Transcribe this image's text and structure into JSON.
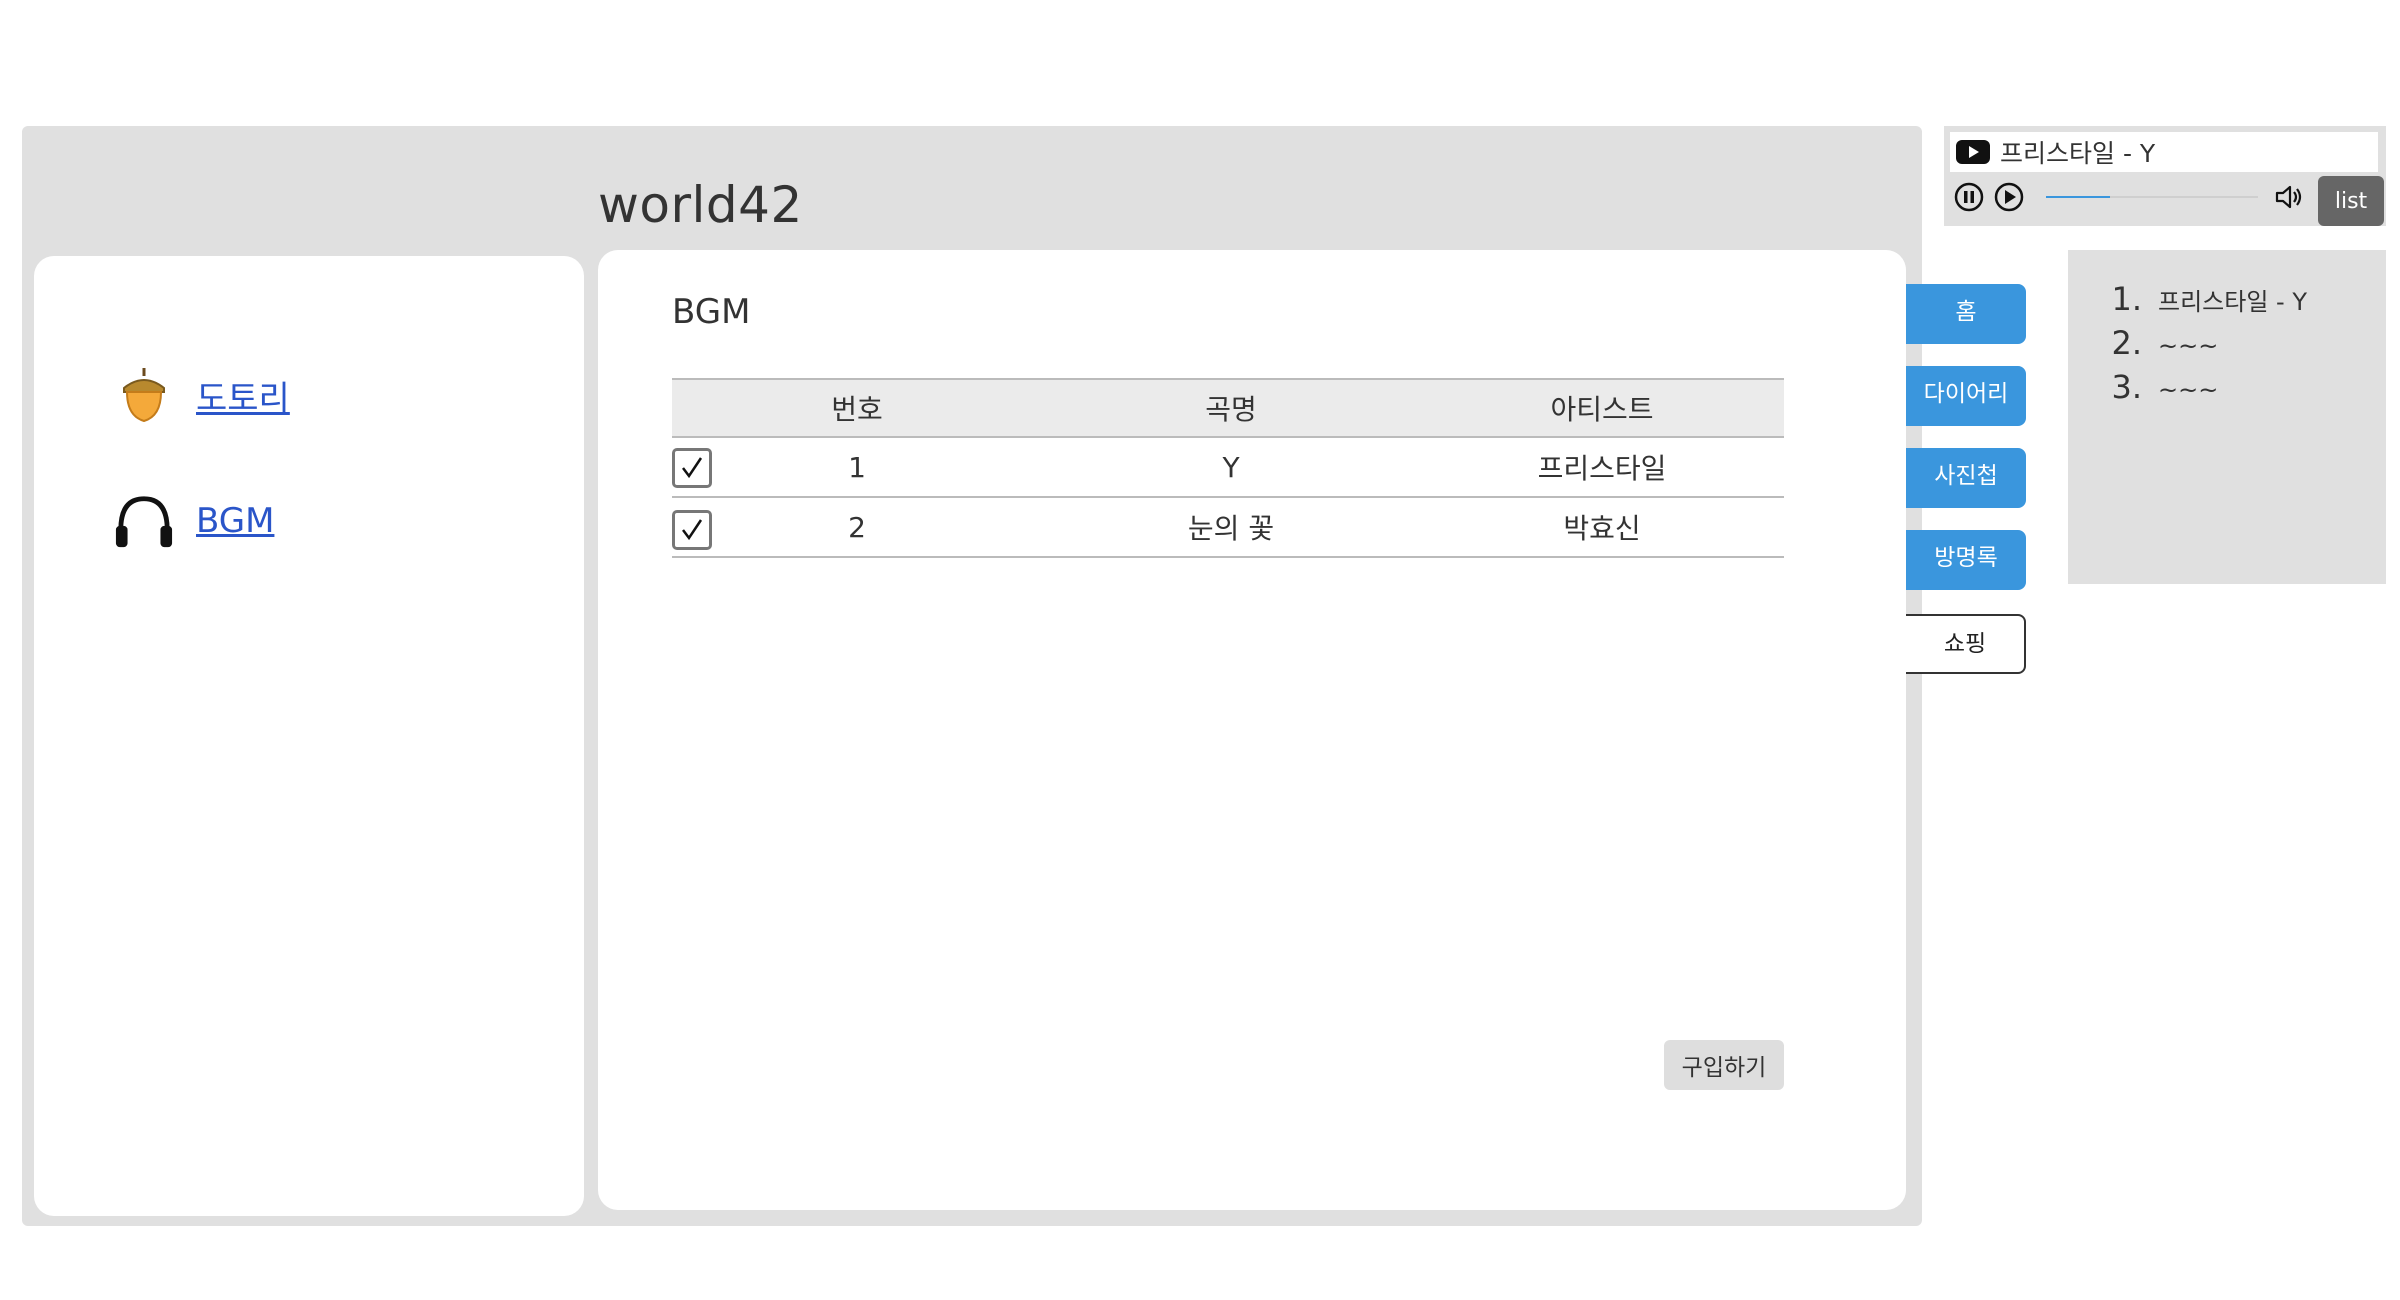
{
  "site": {
    "title": "world42"
  },
  "sidebar": {
    "items": [
      {
        "label": "도토리",
        "icon": "acorn-icon"
      },
      {
        "label": "BGM",
        "icon": "headphones-icon"
      }
    ]
  },
  "main": {
    "section_title": "BGM",
    "table": {
      "headers": [
        "번호",
        "곡명",
        "아티스트"
      ],
      "rows": [
        {
          "checked": true,
          "no": "1",
          "title": "Y",
          "artist": "프리스타일"
        },
        {
          "checked": true,
          "no": "2",
          "title": "눈의 꽃",
          "artist": "박효신"
        }
      ]
    },
    "buy_label": "구입하기"
  },
  "tabs": [
    {
      "label": "홈",
      "active": false
    },
    {
      "label": "다이어리",
      "active": false
    },
    {
      "label": "사진첩",
      "active": false
    },
    {
      "label": "방명록",
      "active": false
    },
    {
      "label": "쇼핑",
      "active": true
    }
  ],
  "player": {
    "now_playing": "프리스타일 - Y",
    "progress": 0.3,
    "list_label": "list"
  },
  "playlist": {
    "items": [
      {
        "num": "1.",
        "title": "프리스타일 - Y"
      },
      {
        "num": "2.",
        "title": "~~~"
      },
      {
        "num": "3.",
        "title": "~~~"
      }
    ]
  },
  "colors": {
    "accent": "#3a96dd",
    "frame": "#e0e0e0",
    "link": "#2a55c9"
  }
}
